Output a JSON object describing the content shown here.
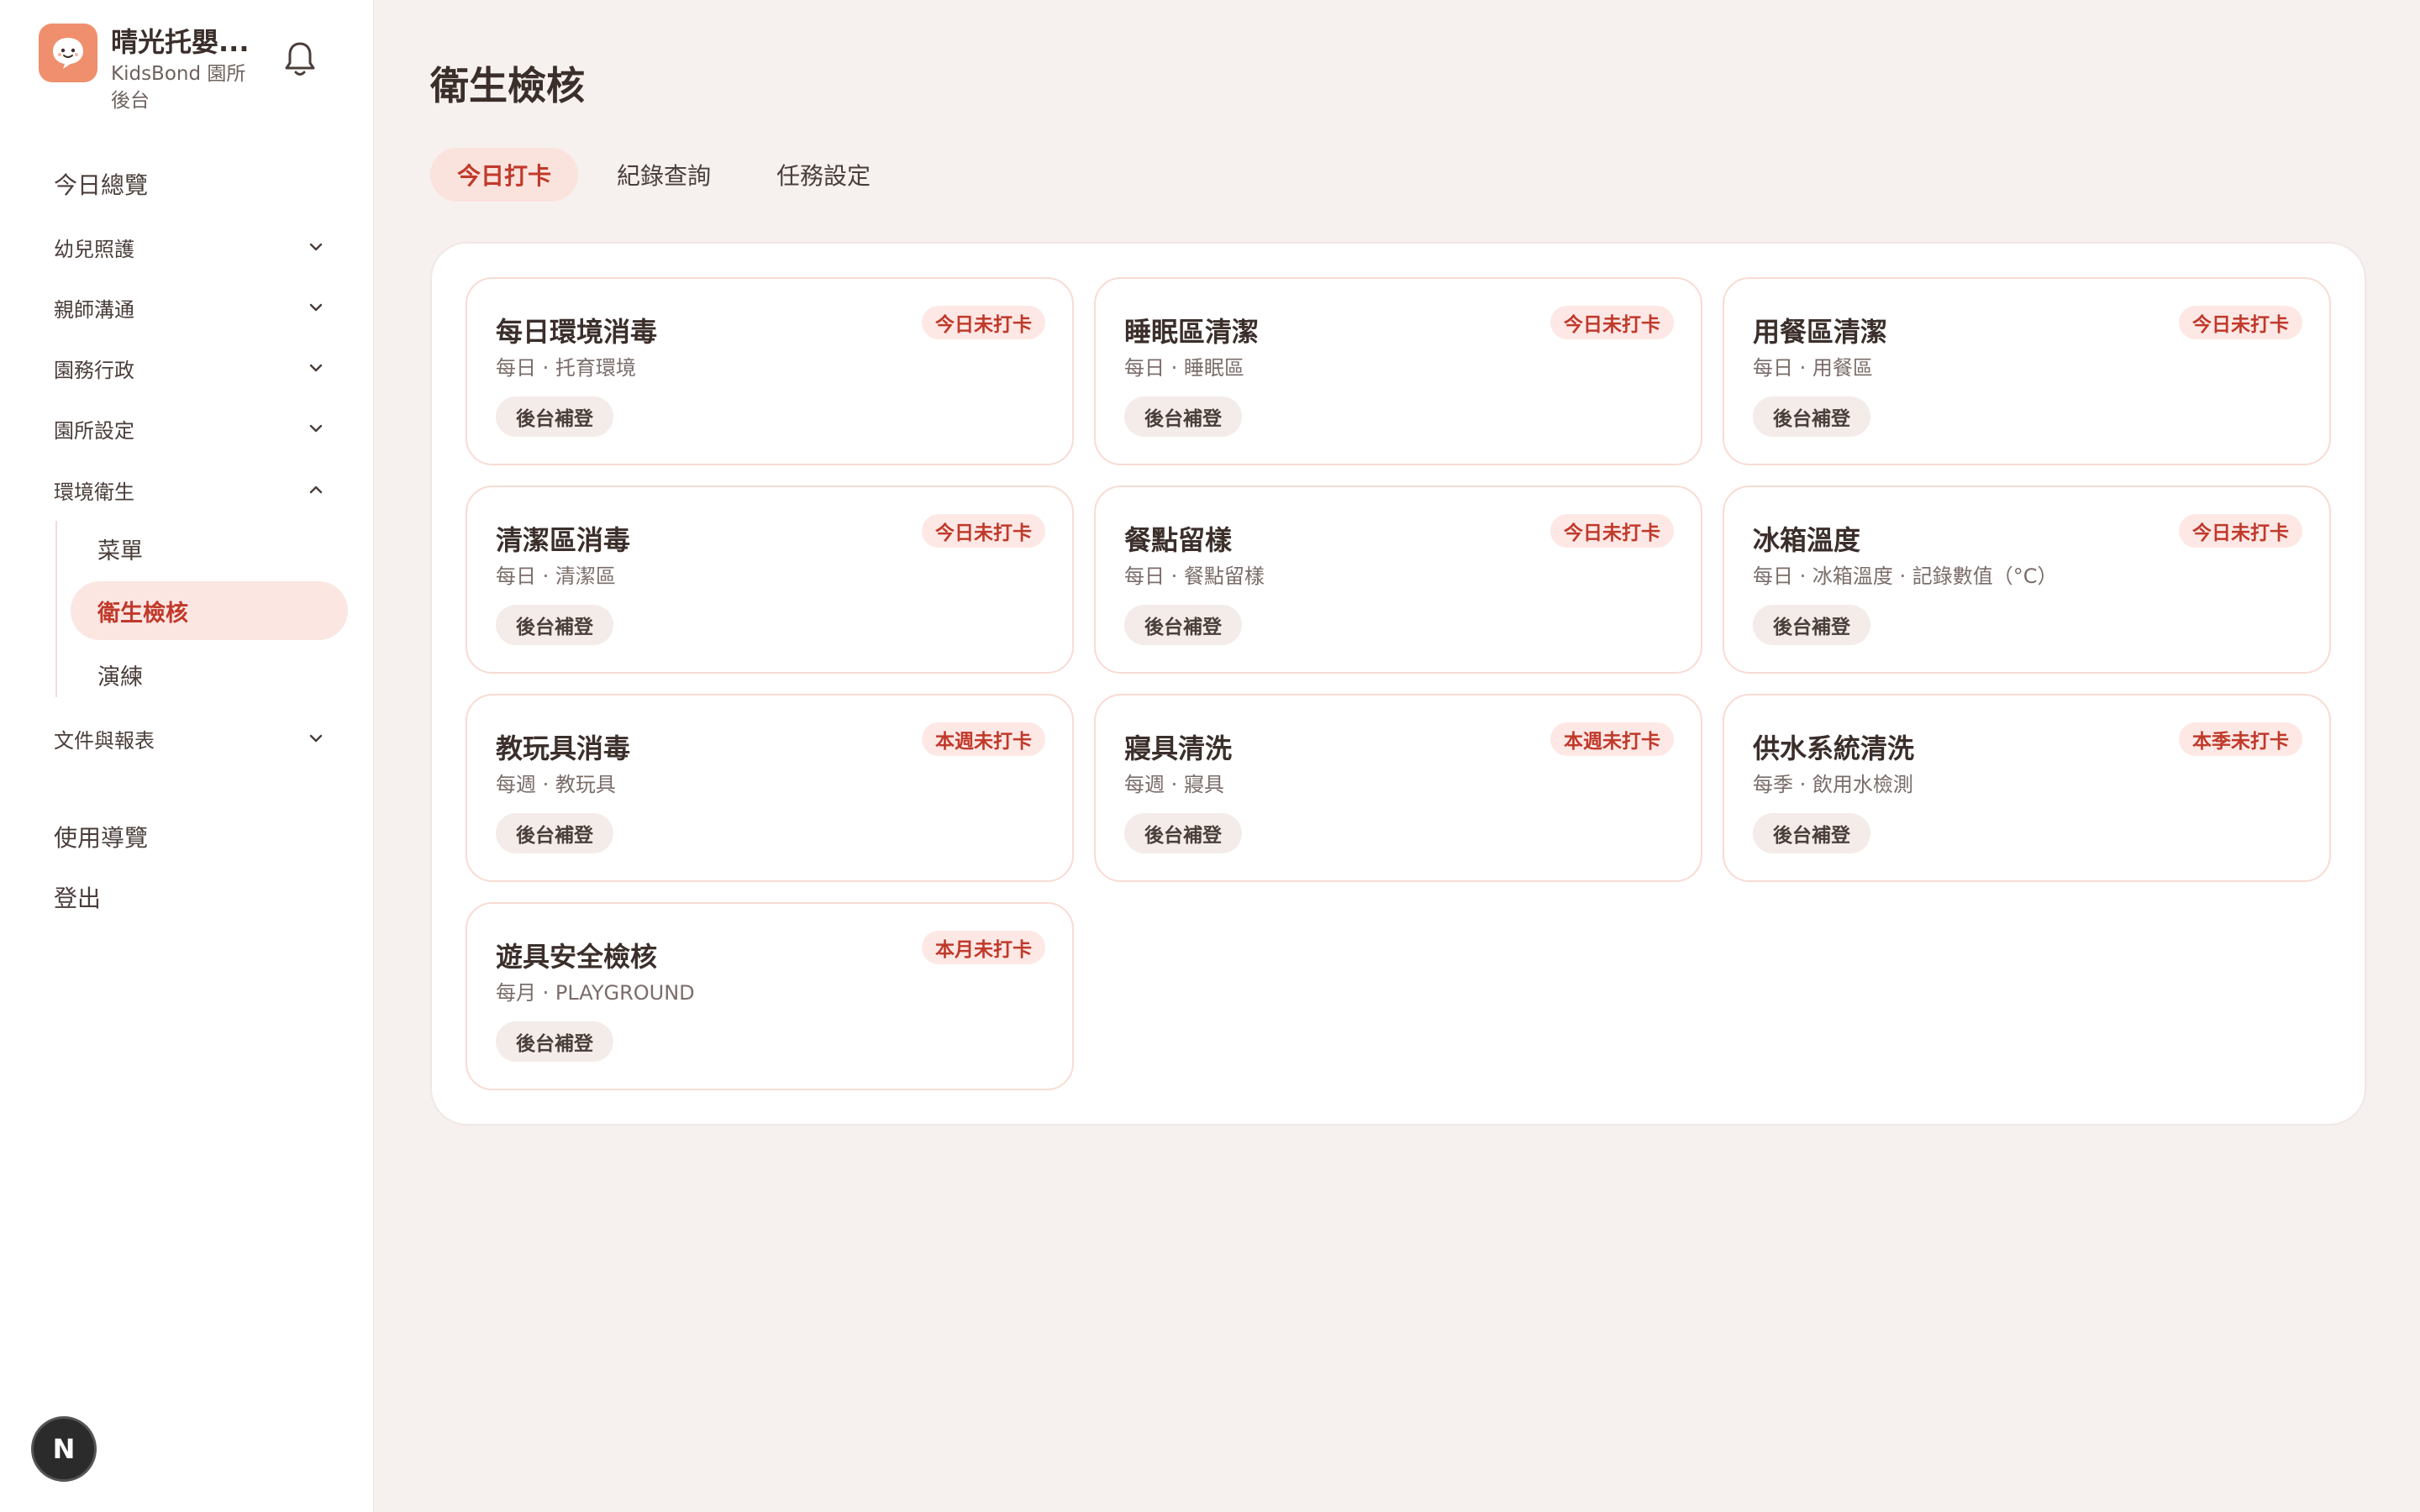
{
  "brand": {
    "name": "晴光托嬰...",
    "subtitle": "KidsBond 園所後台",
    "logo_icon": "chat-bubble-face-icon",
    "accent": "#ef8f6d"
  },
  "header": {
    "notification_icon": "bell-icon"
  },
  "sidebar": {
    "items": [
      {
        "label": "今日總覽"
      },
      {
        "label": "幼兒照護"
      },
      {
        "label": "親師溝通"
      },
      {
        "label": "園務行政"
      },
      {
        "label": "園所設定"
      },
      {
        "label": "環境衛生"
      },
      {
        "label": "文件與報表"
      },
      {
        "label": "使用導覽"
      },
      {
        "label": "登出"
      }
    ],
    "sub_items": [
      {
        "label": "菜單"
      },
      {
        "label": "衛生檢核"
      },
      {
        "label": "演練"
      }
    ]
  },
  "page": {
    "title": "衛生檢核",
    "tabs": [
      {
        "label": "今日打卡"
      },
      {
        "label": "紀錄查詢"
      },
      {
        "label": "任務設定"
      }
    ]
  },
  "tasks": [
    {
      "title": "每日環境消毒",
      "subtitle": "每日 · 托育環境",
      "status": "今日未打卡",
      "action": "後台補登"
    },
    {
      "title": "睡眠區清潔",
      "subtitle": "每日 · 睡眠區",
      "status": "今日未打卡",
      "action": "後台補登"
    },
    {
      "title": "用餐區清潔",
      "subtitle": "每日 · 用餐區",
      "status": "今日未打卡",
      "action": "後台補登"
    },
    {
      "title": "清潔區消毒",
      "subtitle": "每日 · 清潔區",
      "status": "今日未打卡",
      "action": "後台補登"
    },
    {
      "title": "餐點留樣",
      "subtitle": "每日 · 餐點留樣",
      "status": "今日未打卡",
      "action": "後台補登"
    },
    {
      "title": "冰箱溫度",
      "subtitle": "每日 · 冰箱溫度 · 記錄數值（°C）",
      "status": "今日未打卡",
      "action": "後台補登"
    },
    {
      "title": "教玩具消毒",
      "subtitle": "每週 · 教玩具",
      "status": "本週未打卡",
      "action": "後台補登"
    },
    {
      "title": "寢具清洗",
      "subtitle": "每週 · 寢具",
      "status": "本週未打卡",
      "action": "後台補登"
    },
    {
      "title": "供水系統清洗",
      "subtitle": "每季 · 飲用水檢測",
      "status": "本季未打卡",
      "action": "後台補登"
    },
    {
      "title": "遊具安全檢核",
      "subtitle": "每月 · PLAYGROUND",
      "status": "本月未打卡",
      "action": "後台補登"
    }
  ],
  "footer_badge": {
    "label": "N"
  },
  "colors": {
    "active_text": "#c1392b",
    "active_bg": "#fbe6e2",
    "page_bg": "#f6f1ee"
  }
}
